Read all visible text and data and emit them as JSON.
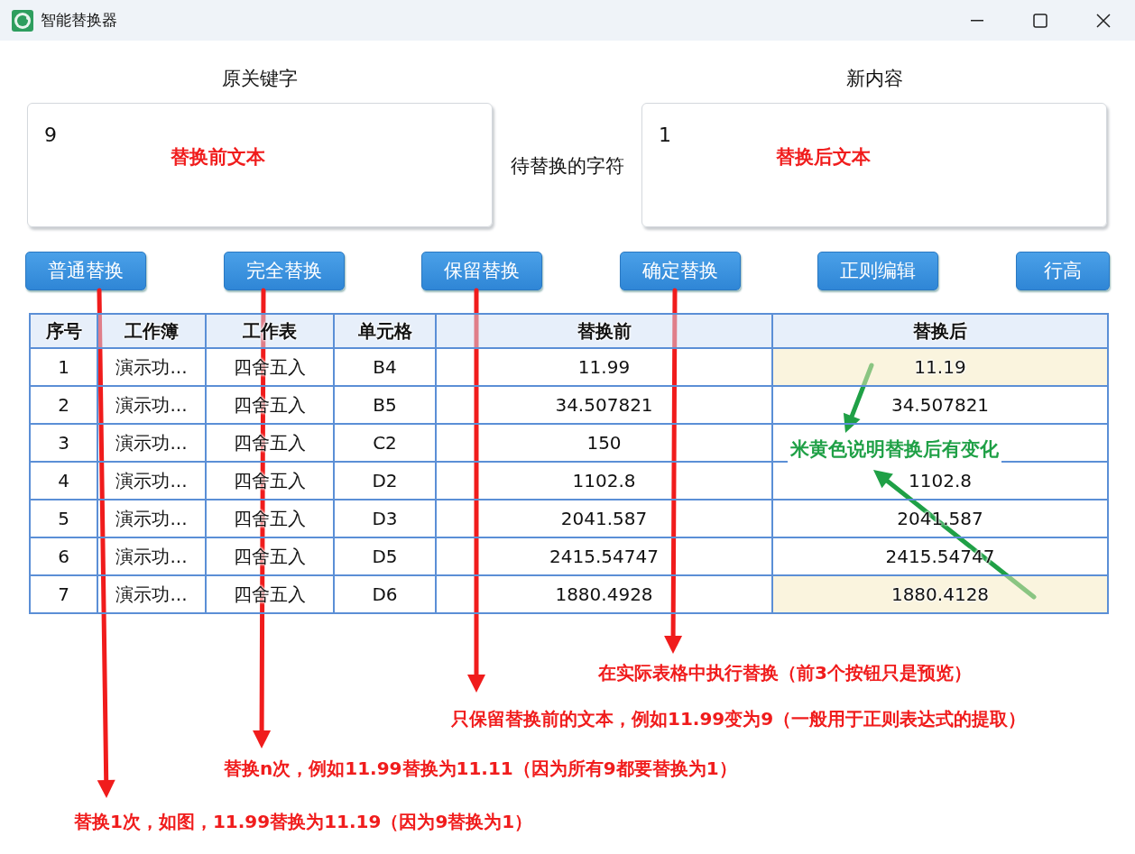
{
  "window": {
    "title": "智能替换器"
  },
  "fields": [
    {
      "label": "原关键字",
      "value": "9",
      "note": "替换前文本"
    },
    {
      "label": "新内容",
      "value": "1",
      "note": "替换后文本"
    }
  ],
  "middle_label": "待替换的字符",
  "buttons": [
    "普通替换",
    "完全替换",
    "保留替换",
    "确定替换",
    "正则编辑",
    "行高"
  ],
  "table": {
    "columns": [
      "序号",
      "工作簿",
      "工作表",
      "单元格",
      "替换前",
      "替换后"
    ],
    "rows": [
      {
        "cells": [
          "1",
          "演示功...",
          "四舍五入",
          "B4",
          "11.99",
          "11.19"
        ],
        "changed": true
      },
      {
        "cells": [
          "2",
          "演示功...",
          "四舍五入",
          "B5",
          "34.507821",
          "34.507821"
        ],
        "changed": false
      },
      {
        "cells": [
          "3",
          "演示功...",
          "四舍五入",
          "C2",
          "150"
        ],
        "changed": false
      },
      {
        "cells": [
          "4",
          "演示功...",
          "四舍五入",
          "D2",
          "1102.8",
          "1102.8"
        ],
        "changed": false
      },
      {
        "cells": [
          "5",
          "演示功...",
          "四舍五入",
          "D3",
          "2041.587",
          "2041.587"
        ],
        "changed": false
      },
      {
        "cells": [
          "6",
          "演示功...",
          "四舍五入",
          "D5",
          "2415.54747",
          "2415.54747"
        ],
        "changed": false
      },
      {
        "cells": [
          "7",
          "演示功...",
          "四舍五入",
          "D6",
          "1880.4928",
          "1880.4128"
        ],
        "changed": true
      }
    ]
  },
  "annotations": [
    {
      "text": "米黄色说明替换后有变化",
      "color": "#1fa046"
    },
    {
      "text": "在实际表格中执行替换（前3个按钮只是预览）",
      "color": "#f01c1c"
    },
    {
      "text": "只保留替换前的文本，例如11.99变为9（一般用于正则表达式的提取）",
      "color": "#f01c1c"
    },
    {
      "text": "替换n次，例如11.99替换为11.11（因为所有9都要替换为1）",
      "color": "#f01c1c"
    },
    {
      "text": "替换1次，如图，11.99替换为11.19（因为9替换为1）",
      "color": "#f01c1c"
    }
  ]
}
